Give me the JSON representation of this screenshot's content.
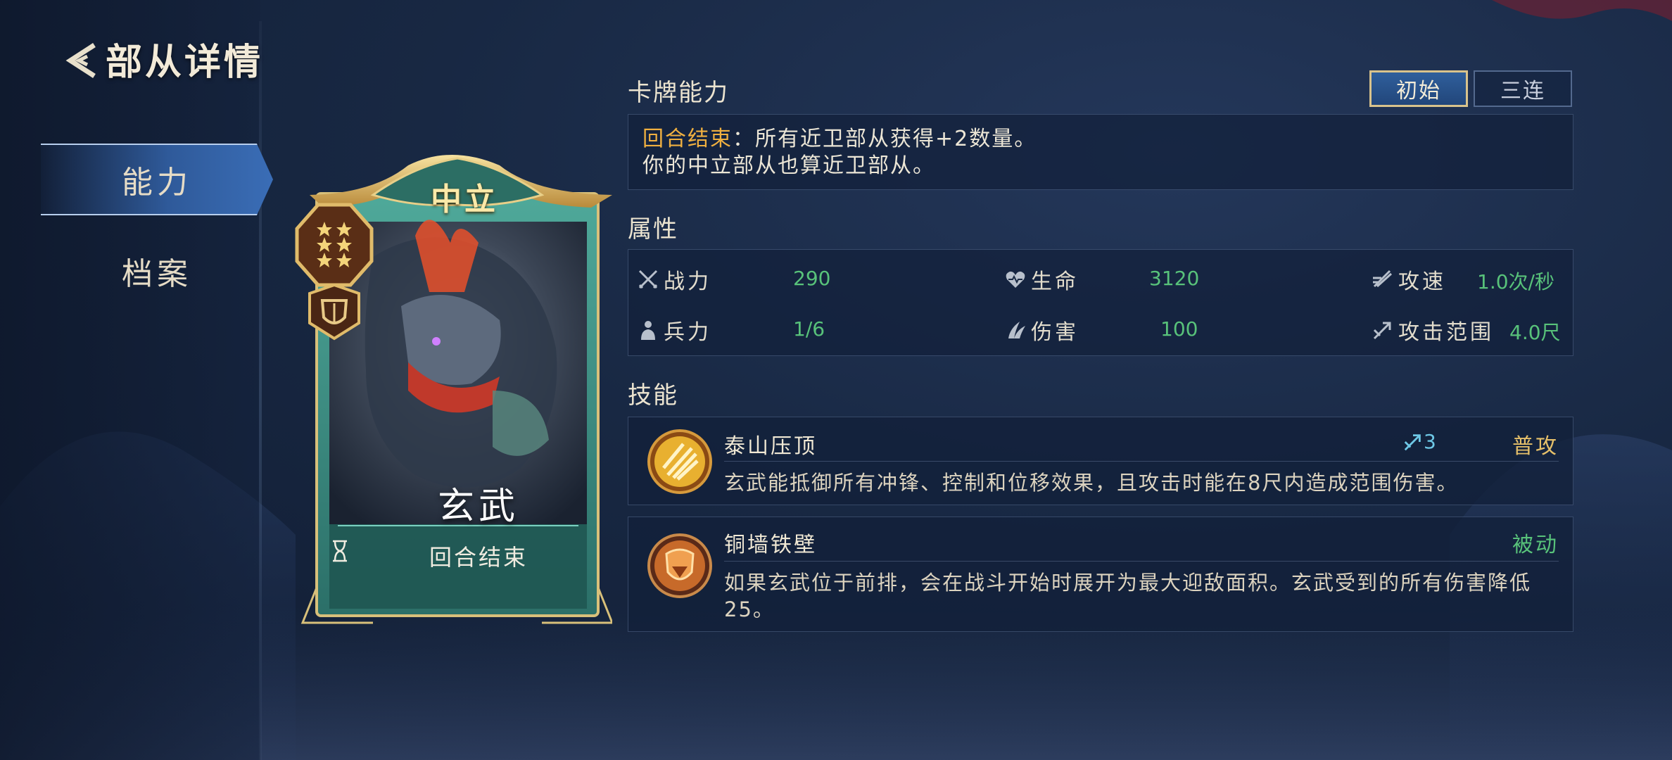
{
  "header": {
    "title": "部从详情"
  },
  "tabs": [
    {
      "label": "能力"
    },
    {
      "label": "档案"
    }
  ],
  "card": {
    "faction": "中立",
    "name": "玄武",
    "trigger": "回合结束",
    "stars": 6
  },
  "ability": {
    "section_title": "卡牌能力",
    "versions": [
      "初始",
      "三连"
    ],
    "highlight": "回合结束",
    "line1_rest": "：所有近卫部从获得+2数量。",
    "line2": "你的中立部从也算近卫部从。"
  },
  "attributes": {
    "section_title": "属性",
    "stats": [
      {
        "label": "战力",
        "value": "290",
        "icon": "crossed-swords-icon"
      },
      {
        "label": "生命",
        "value": "3120",
        "icon": "heart-icon"
      },
      {
        "label": "攻速",
        "value": "1.0次/秒",
        "icon": "speed-icon"
      },
      {
        "label": "兵力",
        "value": "1/6",
        "icon": "troop-icon"
      },
      {
        "label": "伤害",
        "value": "100",
        "icon": "claw-icon"
      },
      {
        "label": "攻击范围",
        "value": "4.0尺",
        "icon": "range-arrow-icon"
      }
    ]
  },
  "skills": {
    "section_title": "技能",
    "items": [
      {
        "name": "泰山压顶",
        "range": "3",
        "type": "普攻",
        "desc": "玄武能抵御所有冲锋、控制和位移效果，且攻击时能在8尺内造成范围伤害。",
        "icon": "fan-burst-icon"
      },
      {
        "name": "铜墙铁壁",
        "type": "被动",
        "desc": "如果玄武位于前排，会在战斗开始时展开为最大迎敌面积。玄武受到的所有伤害降低25。",
        "icon": "shield-icon"
      }
    ]
  },
  "colors": {
    "accent_gold": "#f0b040",
    "value_green": "#58c27a",
    "tab_blue": "#3a6db6"
  }
}
